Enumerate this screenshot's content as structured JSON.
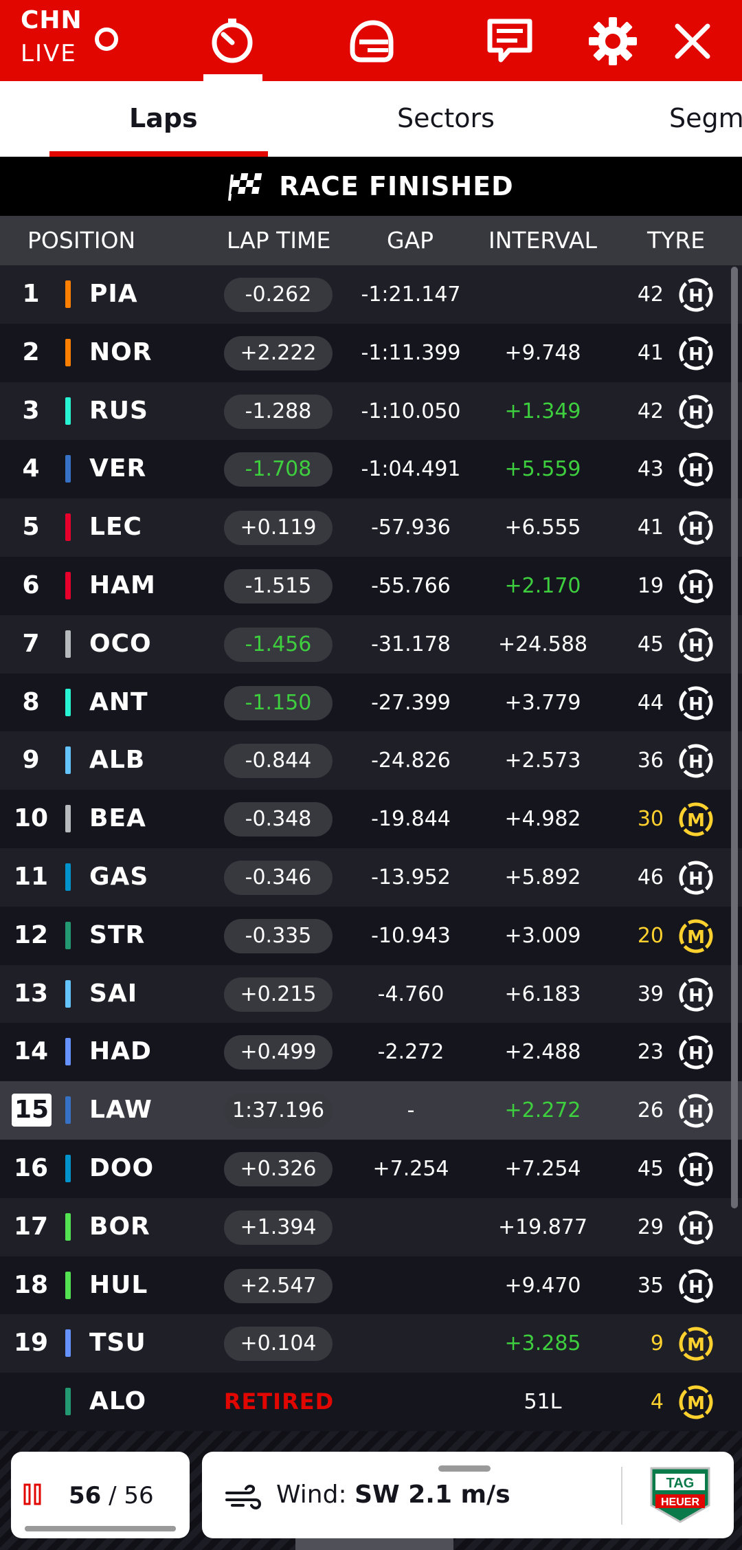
{
  "header": {
    "event_code": "CHN",
    "live_label": "LIVE",
    "icons": [
      "live-indicator-icon",
      "timing-icon",
      "helmet-icon",
      "race-control-icon",
      "gear-icon",
      "close-icon"
    ]
  },
  "tabs": [
    {
      "label": "Laps",
      "active": true
    },
    {
      "label": "Sectors",
      "active": false
    },
    {
      "label": "Segm",
      "active": false
    }
  ],
  "status": {
    "label": "RACE FINISHED",
    "icon": "chequered-flag-icon"
  },
  "columns": {
    "position": "POSITION",
    "lap_time": "LAP TIME",
    "gap": "GAP",
    "interval": "INTERVAL",
    "tyre": "TYRE"
  },
  "colors": {
    "accent": "#e10600",
    "green": "#3ecf3e",
    "yellow": "#ffd12e",
    "hard_tyre": "#ffffff",
    "medium_tyre": "#ffd12e"
  },
  "rows": [
    {
      "pos": "1",
      "driver": "PIA",
      "team_color": "#ff8000",
      "lap": "-0.262",
      "lap_green": false,
      "gap": "-1:21.147",
      "interval": "",
      "interval_green": false,
      "tyre_laps": "42",
      "tyre": "H"
    },
    {
      "pos": "2",
      "driver": "NOR",
      "team_color": "#ff8000",
      "lap": "+2.222",
      "lap_green": false,
      "gap": "-1:11.399",
      "interval": "+9.748",
      "interval_green": false,
      "tyre_laps": "41",
      "tyre": "H"
    },
    {
      "pos": "3",
      "driver": "RUS",
      "team_color": "#27f4d2",
      "lap": "-1.288",
      "lap_green": false,
      "gap": "-1:10.050",
      "interval": "+1.349",
      "interval_green": true,
      "tyre_laps": "42",
      "tyre": "H"
    },
    {
      "pos": "4",
      "driver": "VER",
      "team_color": "#3671c6",
      "lap": "-1.708",
      "lap_green": true,
      "gap": "-1:04.491",
      "interval": "+5.559",
      "interval_green": true,
      "tyre_laps": "43",
      "tyre": "H"
    },
    {
      "pos": "5",
      "driver": "LEC",
      "team_color": "#e8002d",
      "lap": "+0.119",
      "lap_green": false,
      "gap": "-57.936",
      "interval": "+6.555",
      "interval_green": false,
      "tyre_laps": "41",
      "tyre": "H"
    },
    {
      "pos": "6",
      "driver": "HAM",
      "team_color": "#e8002d",
      "lap": "-1.515",
      "lap_green": false,
      "gap": "-55.766",
      "interval": "+2.170",
      "interval_green": true,
      "tyre_laps": "19",
      "tyre": "H"
    },
    {
      "pos": "7",
      "driver": "OCO",
      "team_color": "#b6babd",
      "lap": "-1.456",
      "lap_green": true,
      "gap": "-31.178",
      "interval": "+24.588",
      "interval_green": false,
      "tyre_laps": "45",
      "tyre": "H"
    },
    {
      "pos": "8",
      "driver": "ANT",
      "team_color": "#27f4d2",
      "lap": "-1.150",
      "lap_green": true,
      "gap": "-27.399",
      "interval": "+3.779",
      "interval_green": false,
      "tyre_laps": "44",
      "tyre": "H"
    },
    {
      "pos": "9",
      "driver": "ALB",
      "team_color": "#64c4ff",
      "lap": "-0.844",
      "lap_green": false,
      "gap": "-24.826",
      "interval": "+2.573",
      "interval_green": false,
      "tyre_laps": "36",
      "tyre": "H"
    },
    {
      "pos": "10",
      "driver": "BEA",
      "team_color": "#b6babd",
      "lap": "-0.348",
      "lap_green": false,
      "gap": "-19.844",
      "interval": "+4.982",
      "interval_green": false,
      "tyre_laps": "30",
      "tyre": "M"
    },
    {
      "pos": "11",
      "driver": "GAS",
      "team_color": "#0093cc",
      "lap": "-0.346",
      "lap_green": false,
      "gap": "-13.952",
      "interval": "+5.892",
      "interval_green": false,
      "tyre_laps": "46",
      "tyre": "H"
    },
    {
      "pos": "12",
      "driver": "STR",
      "team_color": "#229971",
      "lap": "-0.335",
      "lap_green": false,
      "gap": "-10.943",
      "interval": "+3.009",
      "interval_green": false,
      "tyre_laps": "20",
      "tyre": "M"
    },
    {
      "pos": "13",
      "driver": "SAI",
      "team_color": "#64c4ff",
      "lap": "+0.215",
      "lap_green": false,
      "gap": "-4.760",
      "interval": "+6.183",
      "interval_green": false,
      "tyre_laps": "39",
      "tyre": "H"
    },
    {
      "pos": "14",
      "driver": "HAD",
      "team_color": "#6692ff",
      "lap": "+0.499",
      "lap_green": false,
      "gap": "-2.272",
      "interval": "+2.488",
      "interval_green": false,
      "tyre_laps": "23",
      "tyre": "H"
    },
    {
      "pos": "15",
      "driver": "LAW",
      "team_color": "#3671c6",
      "lap": "1:37.196",
      "lap_green": false,
      "gap": "-",
      "interval": "+2.272",
      "interval_green": true,
      "tyre_laps": "26",
      "tyre": "H",
      "highlight": true
    },
    {
      "pos": "16",
      "driver": "DOO",
      "team_color": "#0093cc",
      "lap": "+0.326",
      "lap_green": false,
      "gap": "+7.254",
      "interval": "+7.254",
      "interval_green": false,
      "tyre_laps": "45",
      "tyre": "H"
    },
    {
      "pos": "17",
      "driver": "BOR",
      "team_color": "#52e252",
      "lap": "+1.394",
      "lap_green": false,
      "gap": "",
      "interval": "+19.877",
      "interval_green": false,
      "tyre_laps": "29",
      "tyre": "H"
    },
    {
      "pos": "18",
      "driver": "HUL",
      "team_color": "#52e252",
      "lap": "+2.547",
      "lap_green": false,
      "gap": "",
      "interval": "+9.470",
      "interval_green": false,
      "tyre_laps": "35",
      "tyre": "H"
    },
    {
      "pos": "19",
      "driver": "TSU",
      "team_color": "#6692ff",
      "lap": "+0.104",
      "lap_green": false,
      "gap": "",
      "interval": "+3.285",
      "interval_green": true,
      "tyre_laps": "9",
      "tyre": "M",
      "tyre_new": true
    },
    {
      "pos": "",
      "driver": "ALO",
      "team_color": "#229971",
      "lap": "RETIRED",
      "retired": true,
      "gap": "",
      "interval": "51L",
      "interval_green": false,
      "tyre_laps": "4",
      "tyre": "M",
      "tyre_new": true
    }
  ],
  "footer": {
    "current_lap": "56",
    "separator": "/",
    "total_laps": "56",
    "lap_progress": 1.0,
    "wind_label": "Wind:",
    "wind_value": "SW 2.1 m/s",
    "sponsor_line1": "TAG",
    "sponsor_line2": "HEUER"
  }
}
